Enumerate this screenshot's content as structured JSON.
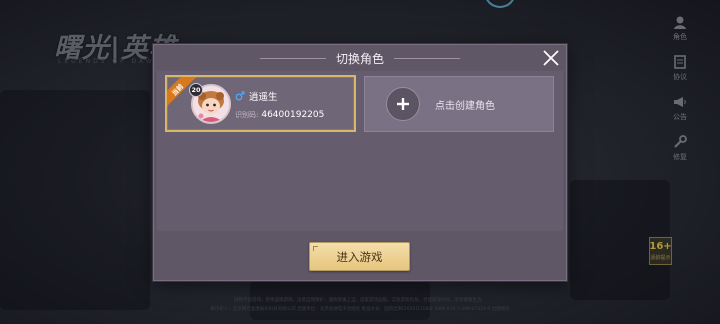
{
  "background": {
    "logo_text": "曙光|英雄",
    "logo_subtext": "LEGENDS OF DAWN",
    "side_menu": [
      {
        "label": "角色",
        "icon": "character-icon"
      },
      {
        "label": "协议",
        "icon": "agreement-icon"
      },
      {
        "label": "公告",
        "icon": "announcement-icon"
      },
      {
        "label": "修复",
        "icon": "repair-icon"
      }
    ],
    "age_rating": {
      "number": "16+",
      "text": "适龄提示"
    },
    "footer_line1": "抵制不良游戏，拒绝盗版游戏。注意自我保护，谨防受骗上当。适度游戏益脑，沉迷游戏伤身。合理安排时间，享受健康生活。",
    "footer_line2": "著作权人：北京网元圣唐娱乐科技有限公司 出版单位：北京伯通电子出版社 批准文号：国新出审[2020]1108号 ISBN 978-7-498-07419-0 出版物号"
  },
  "dialog": {
    "title": "切换角色",
    "close_icon": "close-icon",
    "current_role": {
      "tag": "当前",
      "level": "20",
      "gender": "male",
      "name": "逍遥生",
      "id_label": "识别码:",
      "id_value": "46400192205"
    },
    "create_role_label": "点击创建角色",
    "enter_button": "进入游戏"
  },
  "colors": {
    "dialog_bg": "#5f5766",
    "selected_border": "#d9b768",
    "current_tag": "#d9781c",
    "enter_button": "#efd596",
    "gender_male": "#4ba8ff"
  }
}
